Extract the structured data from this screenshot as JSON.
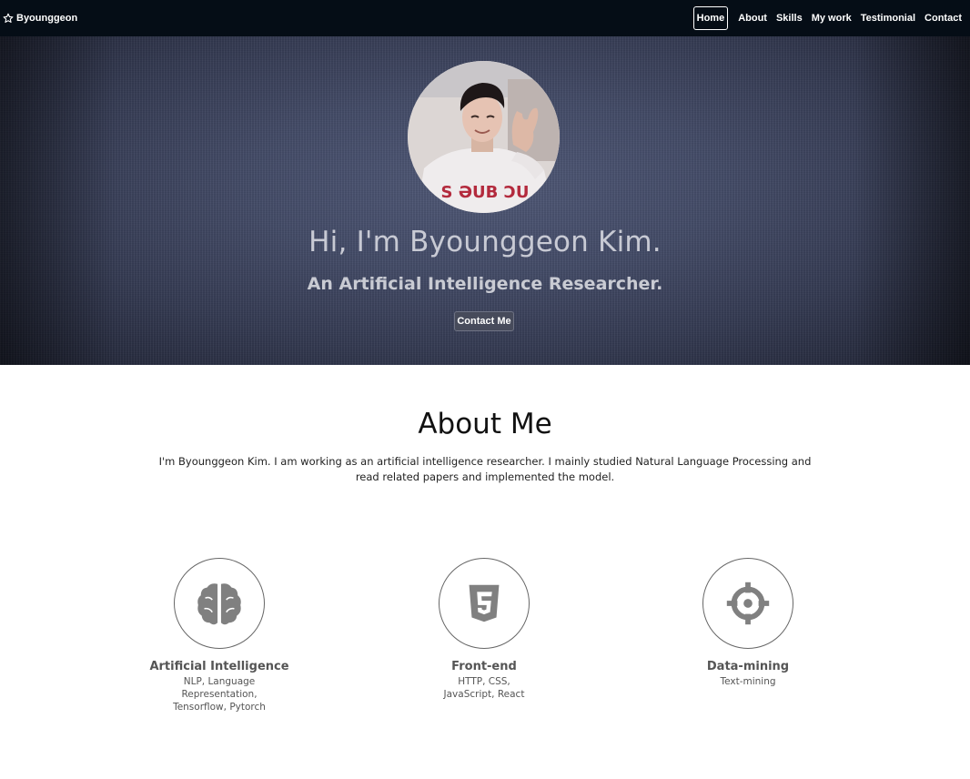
{
  "navbar": {
    "brand": "Byounggeon",
    "links": [
      "Home",
      "About",
      "Skills",
      "My work",
      "Testimonial",
      "Contact"
    ]
  },
  "hero": {
    "title": "Hi, I'm Byounggeon Kim.",
    "subtitle": "An Artificial Intelligence Researcher.",
    "button": "Contact Me"
  },
  "about": {
    "title": "About Me",
    "text": "I'm Byounggeon Kim. I am working as an artificial intelligence researcher. I mainly studied Natural Language Processing and read related papers and implemented the model."
  },
  "skills": [
    {
      "icon": "brain-icon",
      "title": "Artificial Intelligence",
      "desc": "NLP, Language Representation, Tensorflow, Pytorch"
    },
    {
      "icon": "html5-icon",
      "title": "Front-end",
      "desc": "HTTP, CSS, JavaScript, React"
    },
    {
      "icon": "crosshair-icon",
      "title": "Data-mining",
      "desc": "Text-mining"
    }
  ],
  "colors": {
    "navbar_bg": "#050d16",
    "hero_bg": "#434b67",
    "icon_gray": "#808080"
  }
}
